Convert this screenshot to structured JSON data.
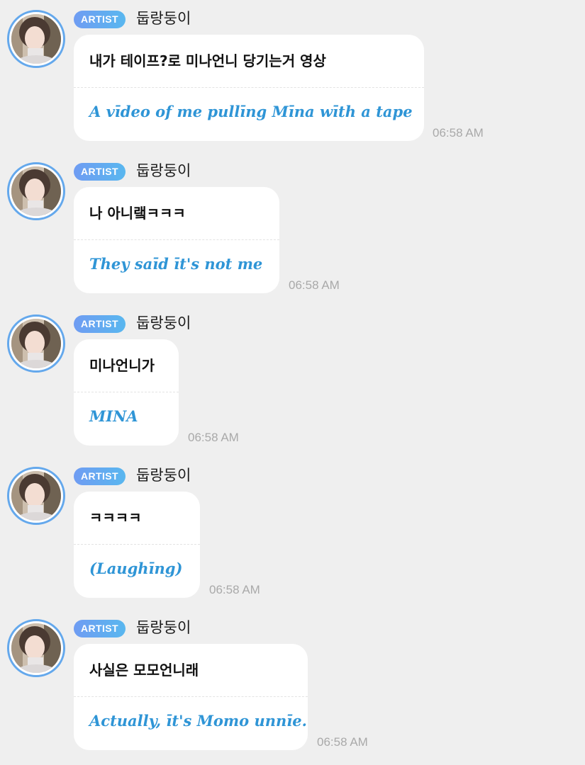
{
  "badge_label": "ARTIST",
  "sender_name": "둡랑둥이",
  "messages": [
    {
      "korean": "내가 테이프?로 미나언니 당기는거 영상",
      "english": "A vīdeo of me pullīng Mīna wīth a tape",
      "time": "06:58 AM"
    },
    {
      "korean": "나 아니랰ㅋㅋㅋ",
      "english": "They saīd īt's not me",
      "time": "06:58 AM"
    },
    {
      "korean": "미나언니가",
      "english": "MINA",
      "time": "06:58 AM"
    },
    {
      "korean": "ㅋㅋㅋㅋ",
      "english": "(Laughīng)",
      "time": "06:58 AM"
    },
    {
      "korean": "사실은 모모언니래",
      "english": "Actually, īt's Momo unnīe.",
      "time": "06:58 AM"
    }
  ],
  "colors": {
    "background": "#efefef",
    "bubble": "#ffffff",
    "translation": "#2f95d6",
    "avatar_ring": "#64a8ec",
    "badge_start": "#6f9cf2",
    "badge_end": "#59b7ef",
    "timestamp": "#a9a9a9"
  }
}
